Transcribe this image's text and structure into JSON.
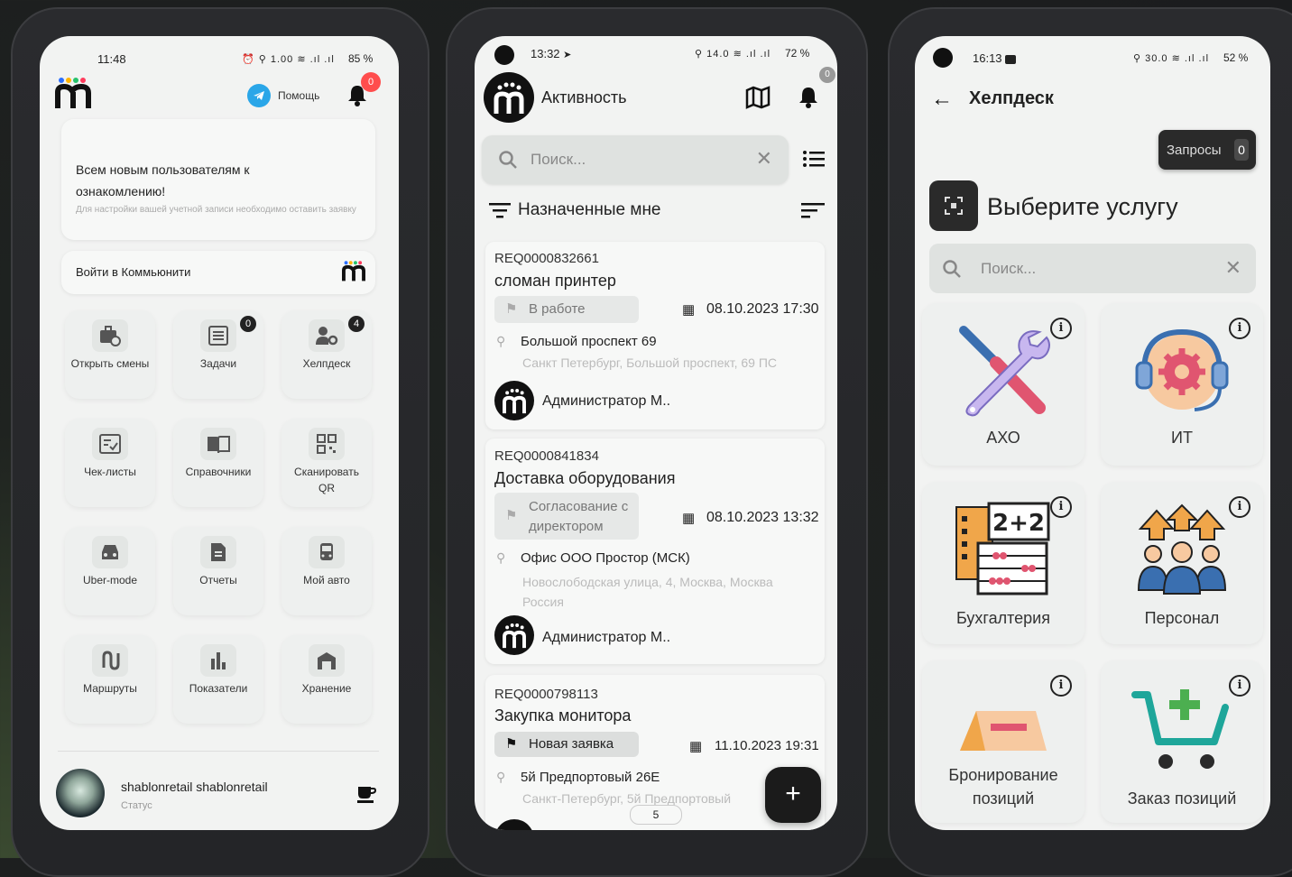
{
  "phone1": {
    "time": "11:48",
    "status_right": "⏰ ⚲ 1.00 ≋ .ıl .ıl",
    "battery": "85 %",
    "help_label": "Помощь",
    "bell_badge": "0",
    "announcement_title": "Всем новым пользователям к ознакомлению!",
    "announcement_body": "Для настройки вашей учетной записи необходимо оставить заявку",
    "community_label": "Войти в Коммьюнити",
    "tiles": [
      {
        "label": "Открыть смены",
        "icon": "briefcase-clock-icon",
        "badge": ""
      },
      {
        "label": "Задачи",
        "icon": "list-icon",
        "badge": "0"
      },
      {
        "label": "Хелпдеск",
        "icon": "user-gear-icon",
        "badge": "4"
      },
      {
        "label": "Чек-листы",
        "icon": "checklist-icon",
        "badge": ""
      },
      {
        "label": "Справочники",
        "icon": "book-icon",
        "badge": ""
      },
      {
        "label": "Сканировать QR",
        "icon": "qr-icon",
        "badge": ""
      },
      {
        "label": "Uber-mode",
        "icon": "car-icon",
        "badge": ""
      },
      {
        "label": "Отчеты",
        "icon": "report-icon",
        "badge": ""
      },
      {
        "label": "Мой авто",
        "icon": "bus-icon",
        "badge": ""
      },
      {
        "label": "Маршруты",
        "icon": "route-icon",
        "badge": ""
      },
      {
        "label": "Показатели",
        "icon": "bar-chart-icon",
        "badge": ""
      },
      {
        "label": "Хранение",
        "icon": "warehouse-icon",
        "badge": ""
      }
    ],
    "user_name": "shablonretail shablonretail",
    "user_status": "Статус"
  },
  "phone2": {
    "time": "13:32",
    "status_right": "⚲ 14.0 ≋ .ıl .ıl",
    "battery": "72 %",
    "title": "Активность",
    "bell_badge": "0",
    "search_placeholder": "Поиск...",
    "filter_title": "Назначенные мне",
    "requests": [
      {
        "id": "REQ0000832661",
        "title": "сломан принтер",
        "status": "В работе",
        "date": "08.10.2023 17:30",
        "place": "Большой проспект 69",
        "address": "Санкт Петербург, Большой проспект, 69 ПС",
        "assignee": "Администратор М.."
      },
      {
        "id": "REQ0000841834",
        "title": "Доставка оборудования",
        "status": "Согласование с директором",
        "date": "08.10.2023 13:32",
        "place": "Офис ООО Простор (МСК)",
        "address": "Новослободская улица, 4, Москва, Москва Россия",
        "assignee": "Администратор М.."
      },
      {
        "id": "REQ0000798113",
        "title": "Закупка монитора",
        "status": "Новая заявка",
        "date": "11.10.2023 19:31",
        "place": "5й Предпортовый 26Е",
        "address": "Санкт-Петербург, 5й Предпортовый",
        "assignee": ""
      }
    ],
    "page_number": "5",
    "fab": "+"
  },
  "phone3": {
    "time": "16:13",
    "status_right": "⚲ 30.0 ≋ .ıl .ıl",
    "battery": "52 %",
    "title": "Хелпдеск",
    "requests_label": "Запросы",
    "requests_count": "0",
    "heading": "Выберите услугу",
    "search_placeholder": "Поиск...",
    "services": [
      {
        "name": "АХО",
        "icon": "tools-icon"
      },
      {
        "name": "ИТ",
        "icon": "headset-gear-icon"
      },
      {
        "name": "Бухгалтерия",
        "icon": "abacus-icon"
      },
      {
        "name": "Персонал",
        "icon": "people-icon"
      },
      {
        "name": "Бронирование позиций",
        "icon": "booking-icon"
      },
      {
        "name": "Заказ позиций",
        "icon": "cart-icon"
      }
    ]
  }
}
